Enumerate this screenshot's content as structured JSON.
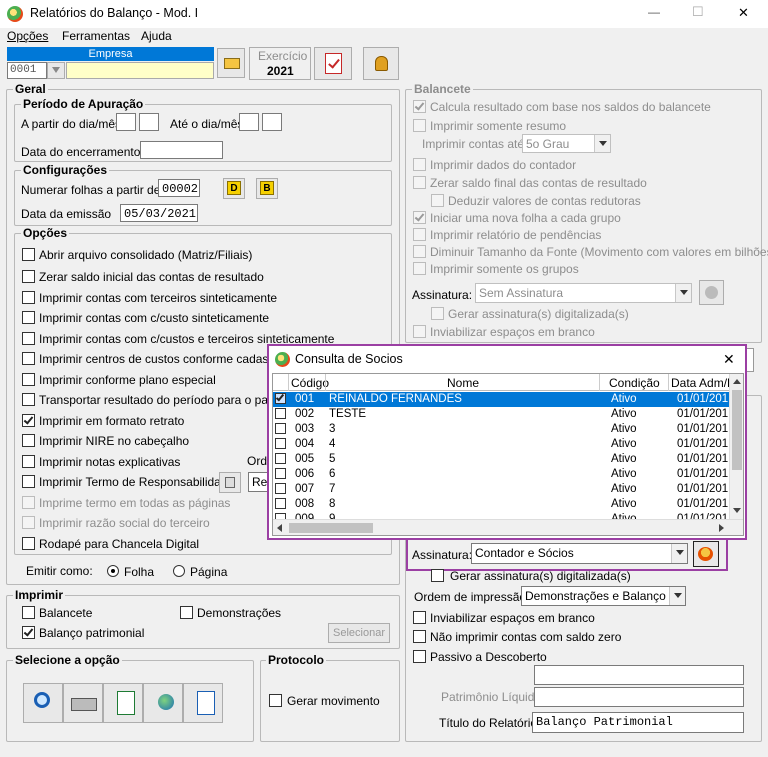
{
  "window": {
    "title": "Relatórios do Balanço - Mod. I",
    "minimize": "—",
    "maximize": "☐",
    "close": "✕"
  },
  "menu": [
    "Opções",
    "Ferramentas",
    "Ajuda"
  ],
  "toolbar": {
    "empresa_label": "Empresa",
    "empresa_code": "0001",
    "exercicio_label": "Exercício",
    "exercicio_value": "2021"
  },
  "geral": {
    "title": "Geral",
    "periodo": {
      "title": "Período de Apuração",
      "from_label": "A partir do dia/mês",
      "to_label": "Até o dia/mês",
      "closing_label": "Data do encerramento"
    },
    "config": {
      "title": "Configurações",
      "numerar_label": "Numerar folhas a partir de",
      "numerar_value": "00002",
      "btn_d": "D",
      "btn_b": "B",
      "emissao_label": "Data da emissão",
      "emissao_value": "05/03/2021"
    },
    "opcoes": {
      "title": "Opções",
      "items": [
        {
          "label": "Abrir arquivo consolidado (Matriz/Filiais)",
          "checked": false,
          "disabled": false
        },
        {
          "label": "Zerar saldo inicial das contas de resultado",
          "checked": false,
          "disabled": false
        },
        {
          "label": "Imprimir contas com terceiros sinteticamente",
          "checked": false,
          "disabled": false
        },
        {
          "label": "Imprimir contas com c/custo sinteticamente",
          "checked": false,
          "disabled": false
        },
        {
          "label": "Imprimir contas com c/custos e terceiros sinteticamente",
          "checked": false,
          "disabled": false
        },
        {
          "label": "Imprimir centros de custos conforme cadastro",
          "checked": false,
          "disabled": false
        },
        {
          "label": "Imprimir conforme plano especial",
          "checked": false,
          "disabled": false
        },
        {
          "label": "Transportar resultado do período para o passivo",
          "checked": false,
          "disabled": false
        },
        {
          "label": "Imprimir em formato retrato",
          "checked": true,
          "disabled": false
        },
        {
          "label": "Imprimir NIRE no cabeçalho",
          "checked": false,
          "disabled": false
        },
        {
          "label": "Imprimir notas explicativas",
          "checked": false,
          "disabled": false
        },
        {
          "label": "Imprimir Termo de Responsabilidade",
          "checked": false,
          "disabled": false
        },
        {
          "label": "Imprime termo em todas as páginas",
          "checked": false,
          "disabled": true
        },
        {
          "label": "Imprimir razão social do terceiro",
          "checked": false,
          "disabled": true
        },
        {
          "label": "Rodapé para Chancela Digital",
          "checked": false,
          "disabled": false
        }
      ],
      "ordem_label": "Ord",
      "termo_combo": "Rec"
    },
    "emitir": {
      "label": "Emitir como:",
      "folha": "Folha",
      "pagina": "Página"
    }
  },
  "imprimir": {
    "title": "Imprimir",
    "balancete": "Balancete",
    "demonstracoes": "Demonstrações",
    "balanco": "Balanço patrimonial",
    "selecionar": "Selecionar"
  },
  "selecione": {
    "title": "Selecione a opção"
  },
  "protocolo": {
    "title": "Protocolo",
    "gerar": "Gerar movimento"
  },
  "balancete": {
    "title": "Balancete",
    "items": [
      {
        "label": "Calcula resultado com base nos saldos do balancete",
        "checked": true
      },
      {
        "label": "Imprimir somente resumo",
        "checked": false
      }
    ],
    "contas_label": "Imprimir contas até:",
    "contas_value": "5o Grau",
    "items2": [
      {
        "label": "Imprimir dados do contador",
        "checked": false,
        "indent": false
      },
      {
        "label": "Zerar saldo final das contas de resultado",
        "checked": false,
        "indent": false
      },
      {
        "label": "Deduzir valores de contas redutoras",
        "checked": false,
        "indent": true
      },
      {
        "label": "Iniciar uma nova folha a cada grupo",
        "checked": true,
        "indent": false
      },
      {
        "label": "Imprimir relatório de pendências",
        "checked": false,
        "indent": false
      },
      {
        "label": "Diminuir Tamanho da Fonte (Movimento com valores em bilhões)",
        "checked": false,
        "indent": false
      },
      {
        "label": "Imprimir somente os grupos",
        "checked": false,
        "indent": false
      }
    ],
    "assinatura_label": "Assinatura:",
    "assinatura_value": "Sem Assinatura",
    "gerar_dig": "Gerar assinatura(s) digitalizada(s)",
    "inviabilizar": "Inviabilizar espaços em branco"
  },
  "balanco": {
    "assinatura_label": "Assinatura:",
    "assinatura_value": "Contador e Sócios",
    "gerar_dig": "Gerar assinatura(s) digitalizada(s)",
    "ordem_label": "Ordem de impressão:",
    "ordem_value": "Demonstrações e Balanço",
    "inviabilizar": "Inviabilizar espaços em branco",
    "nao_imprimir": "Não imprimir contas com saldo zero",
    "passivo": "Passivo a Descoberto",
    "patrimonio_label": "Patrimônio Líquido",
    "titulo_label": "Título do Relatório:",
    "titulo_value": "Balanço Patrimonial"
  },
  "dialog": {
    "title": "Consulta de Socios",
    "close": "✕",
    "columns": [
      "Código",
      "Nome",
      "Condição",
      "Data Adm/D"
    ],
    "rows": [
      {
        "checked": true,
        "codigo": "001",
        "nome": "REINALDO FERNANDES",
        "condicao": "Ativo",
        "data": "01/01/201"
      },
      {
        "checked": false,
        "codigo": "002",
        "nome": "TESTE",
        "condicao": "Ativo",
        "data": "01/01/201"
      },
      {
        "checked": false,
        "codigo": "003",
        "nome": "3",
        "condicao": "Ativo",
        "data": "01/01/201"
      },
      {
        "checked": false,
        "codigo": "004",
        "nome": "4",
        "condicao": "Ativo",
        "data": "01/01/201"
      },
      {
        "checked": false,
        "codigo": "005",
        "nome": "5",
        "condicao": "Ativo",
        "data": "01/01/201"
      },
      {
        "checked": false,
        "codigo": "006",
        "nome": "6",
        "condicao": "Ativo",
        "data": "01/01/201"
      },
      {
        "checked": false,
        "codigo": "007",
        "nome": "7",
        "condicao": "Ativo",
        "data": "01/01/201"
      },
      {
        "checked": false,
        "codigo": "008",
        "nome": "8",
        "condicao": "Ativo",
        "data": "01/01/201"
      },
      {
        "checked": false,
        "codigo": "009",
        "nome": "9",
        "condicao": "Ativo",
        "data": "01/01/201"
      }
    ]
  },
  "colors": {
    "accent": "#0078d7",
    "highlight_border": "#9b3fa3",
    "title_bar": "#ffffff"
  }
}
